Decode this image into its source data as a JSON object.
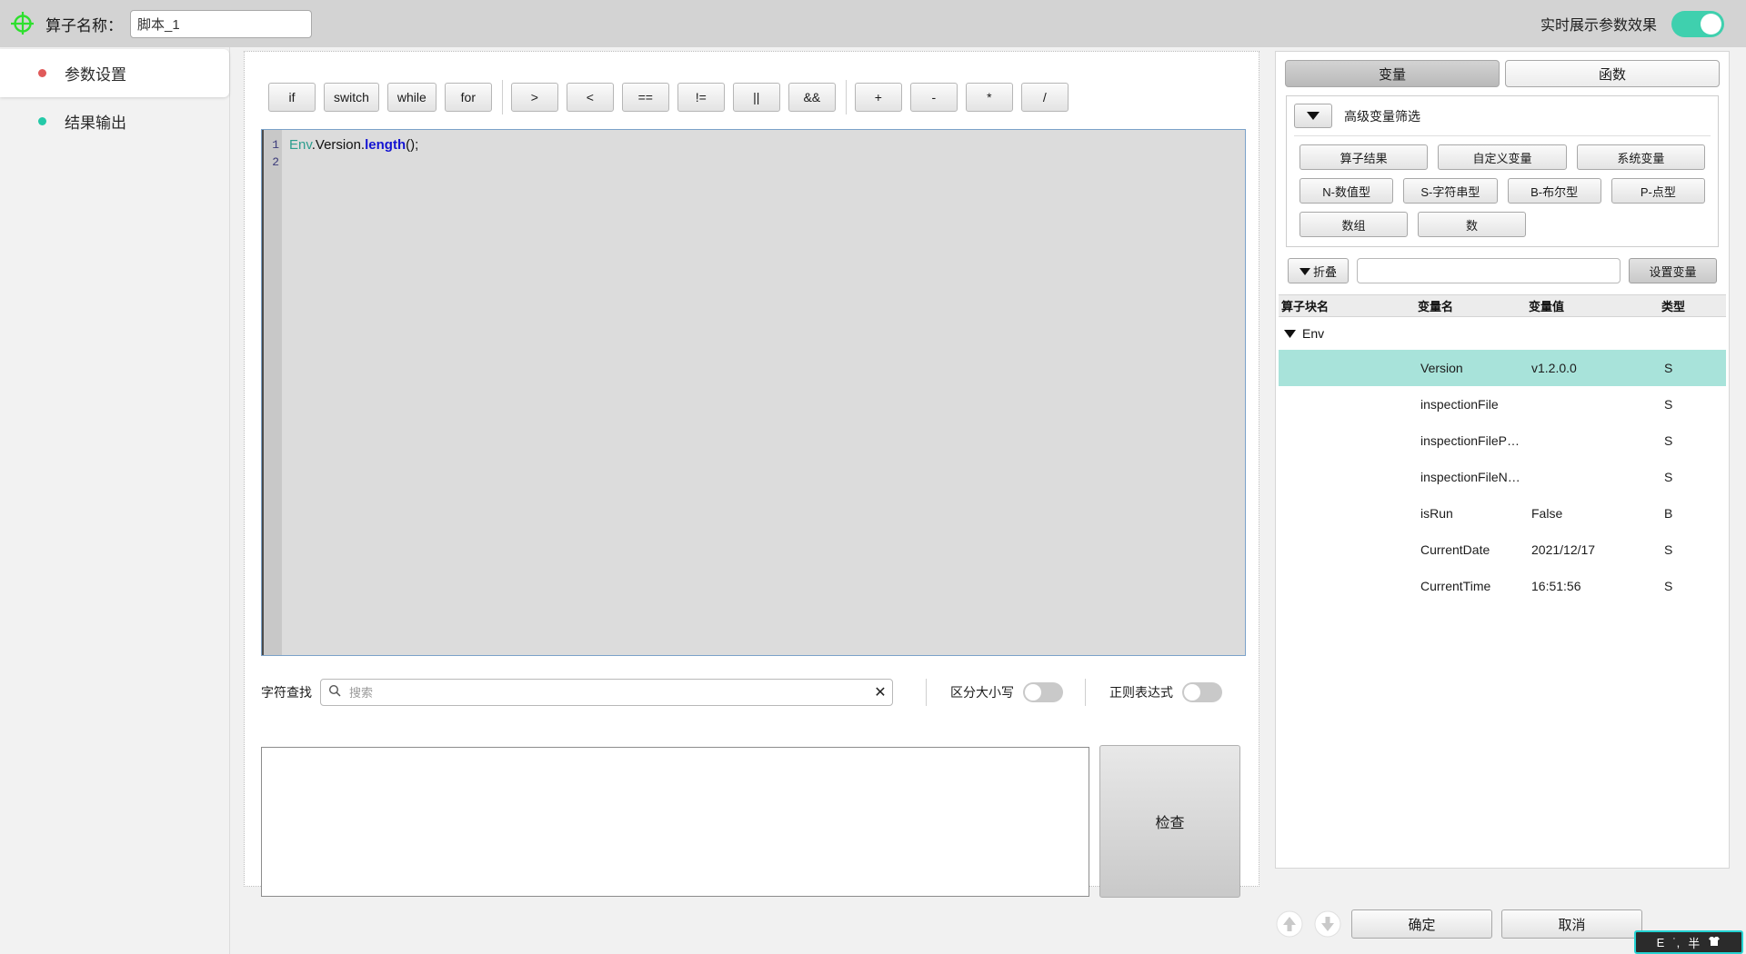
{
  "topbar": {
    "icon": "crosshair-target-icon",
    "name_label": "算子名称：",
    "name_value": "脚本_1",
    "realtime_label": "实时展示参数效果",
    "realtime_on": true,
    "accent_color": "#3fd0ae"
  },
  "sidebar": {
    "items": [
      {
        "label": "参数设置",
        "dot_color": "#e05a5a",
        "active": true
      },
      {
        "label": "结果输出",
        "dot_color": "#24c9a8",
        "active": false
      }
    ]
  },
  "toolbar": {
    "groups": [
      {
        "buttons": [
          "if",
          "switch",
          "while",
          "for"
        ]
      },
      {
        "buttons": [
          ">",
          "<",
          "==",
          "!=",
          "||",
          "&&"
        ]
      },
      {
        "buttons": [
          "+",
          "-",
          "*",
          "/"
        ]
      }
    ]
  },
  "editor": {
    "line_numbers": [
      "1",
      "2"
    ],
    "code_tokens": [
      {
        "text": "Env",
        "type": "obj"
      },
      {
        "text": ".Version.",
        "type": "plain"
      },
      {
        "text": "length",
        "type": "fn"
      },
      {
        "text": "();",
        "type": "plain"
      }
    ],
    "border_color": "#7ba2c9"
  },
  "find": {
    "label": "字符查找",
    "icon": "search-icon",
    "placeholder": "搜索",
    "value": "",
    "clear_icon": "close-x-icon",
    "case_label": "区分大小写",
    "case_on": false,
    "regex_label": "正则表达式",
    "regex_on": false
  },
  "output": {
    "value": ""
  },
  "check": {
    "label": "检查"
  },
  "right_panel": {
    "tabs": [
      {
        "label": "变量",
        "active": true
      },
      {
        "label": "函数",
        "active": false
      }
    ],
    "advanced": {
      "toggle_icon": "chevron-down-icon",
      "label": "高级变量筛选"
    },
    "filters": [
      [
        "算子结果",
        "自定义变量",
        "系统变量"
      ],
      [
        "N-数值型",
        "S-字符串型",
        "B-布尔型",
        "P-点型"
      ],
      [
        "数组",
        "数"
      ]
    ],
    "tools": {
      "collapse_icon": "triangle-down-icon",
      "collapse_label": "折叠",
      "search_value": "",
      "search_placeholder": "",
      "setvar_label": "设置变量"
    },
    "table": {
      "columns": [
        "算子块名",
        "变量名",
        "变量值",
        "类型"
      ],
      "group": {
        "label": "Env",
        "expanded": true
      },
      "rows": [
        {
          "block": "",
          "name": "Version",
          "value": "v1.2.0.0",
          "type": "S",
          "selected": true
        },
        {
          "block": "",
          "name": "inspectionFile",
          "value": "",
          "type": "S",
          "selected": false
        },
        {
          "block": "",
          "name": "inspectionFileP…",
          "value": "",
          "type": "S",
          "selected": false
        },
        {
          "block": "",
          "name": "inspectionFileN…",
          "value": "",
          "type": "S",
          "selected": false
        },
        {
          "block": "",
          "name": "isRun",
          "value": "False",
          "type": "B",
          "selected": false
        },
        {
          "block": "",
          "name": "CurrentDate",
          "value": "2021/12/17",
          "type": "S",
          "selected": false
        },
        {
          "block": "",
          "name": "CurrentTime",
          "value": "16:51:56",
          "type": "S",
          "selected": false
        }
      ],
      "selection_color": "#a8e3da"
    }
  },
  "bottom": {
    "move_up_icon": "arrow-up-circle-icon",
    "move_down_icon": "arrow-down-circle-icon",
    "confirm_label": "确定",
    "cancel_label": "取消"
  },
  "ime": {
    "mode": "E",
    "punct": "˙,",
    "width_label": "半",
    "icon": "ime-shirt-icon",
    "border_color": "#24d2d2"
  }
}
